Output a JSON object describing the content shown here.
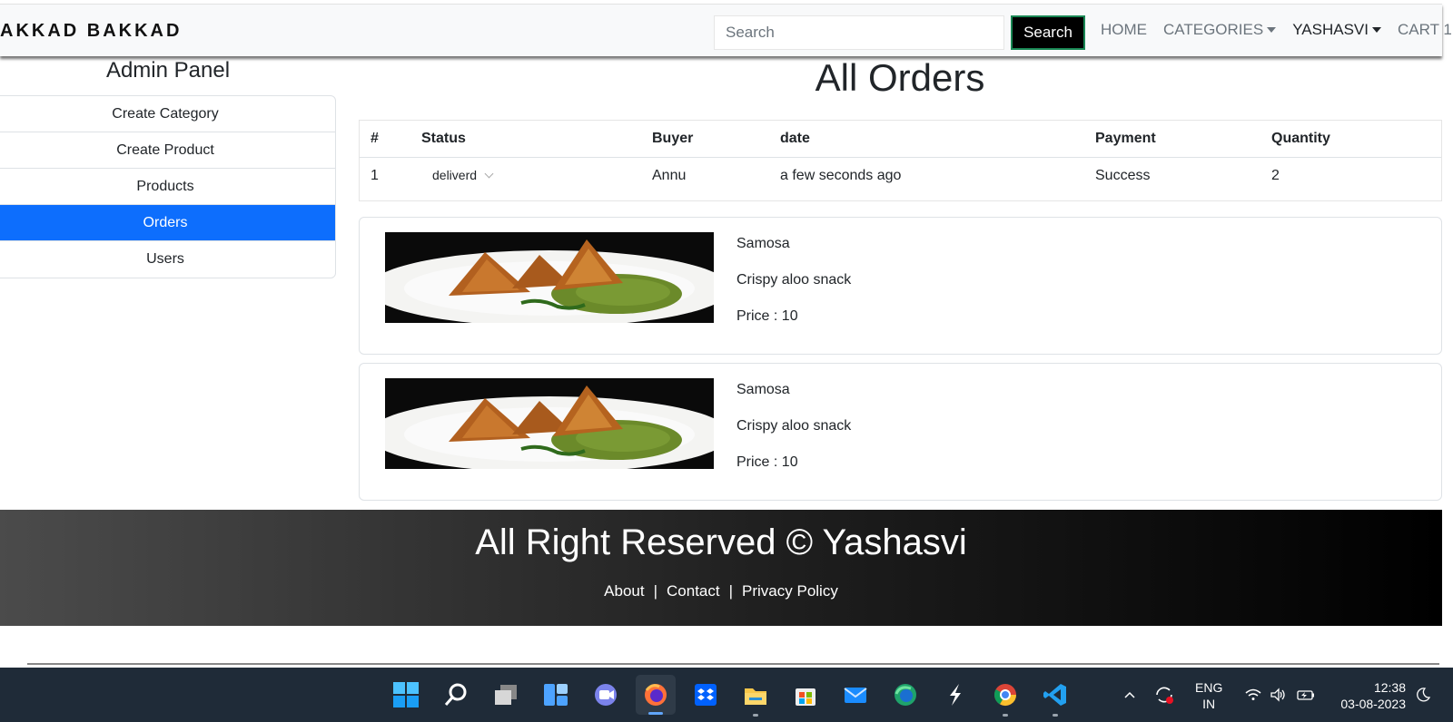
{
  "navbar": {
    "brand": "AKKAD BAKKAD",
    "search_placeholder": "Search",
    "search_button": "Search",
    "links": {
      "home": "HOME",
      "categories": "CATEGORIES",
      "user": "YASHASVI",
      "cart": "CART 1"
    }
  },
  "sidebar": {
    "title": "Admin Panel",
    "items": [
      "Create Category",
      "Create Product",
      "Products",
      "Orders",
      "Users"
    ],
    "active": "Orders"
  },
  "main": {
    "title": "All Orders",
    "table": {
      "headers": [
        "#",
        "Status",
        "Buyer",
        "date",
        "Payment",
        "Quantity"
      ],
      "row": {
        "index": "1",
        "status": "deliverd",
        "buyer": "Annu",
        "date": "a few seconds ago",
        "payment": "Success",
        "quantity": "2"
      }
    },
    "products": [
      {
        "name": "Samosa",
        "description": "Crispy aloo snack",
        "price": "Price : 10"
      },
      {
        "name": "Samosa",
        "description": "Crispy aloo snack",
        "price": "Price : 10"
      }
    ]
  },
  "footer": {
    "title": "All Right Reserved © Yashasvi",
    "links": [
      "About",
      "Contact",
      "Privacy Policy"
    ],
    "separator": "|"
  },
  "taskbar": {
    "apps": [
      "start-icon",
      "search-icon",
      "task-view-icon",
      "widgets-icon",
      "chat-icon",
      "firefox-icon",
      "dropbox-icon",
      "file-explorer-icon",
      "store-icon",
      "mail-icon",
      "edge-icon",
      "app-s-icon",
      "chrome-icon",
      "vscode-icon"
    ],
    "lang_line1": "ENG",
    "lang_line2": "IN",
    "time": "12:38",
    "date": "03-08-2023"
  },
  "colors": {
    "accent": "#0d6efd",
    "taskbar": "#1f2b38",
    "search_button": "#000000"
  }
}
